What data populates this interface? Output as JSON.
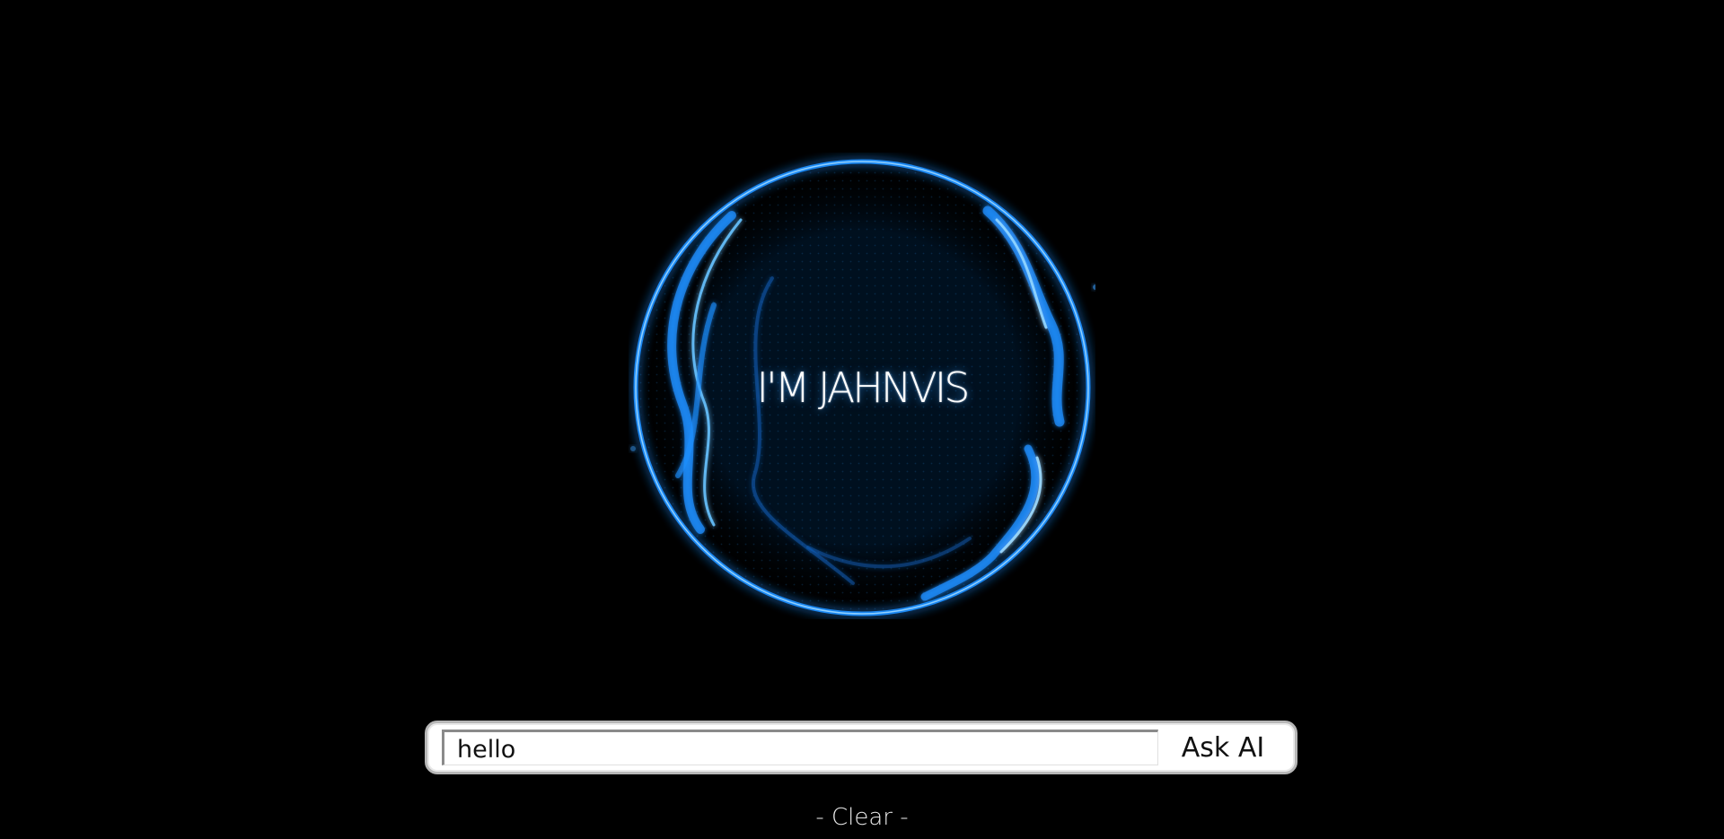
{
  "orb": {
    "title": "I'M JAHNVIS",
    "glow_color": "#1e90ff",
    "icon": "glowing-particle-sphere"
  },
  "ask": {
    "input_value": "hello",
    "button_label": "Ask AI"
  },
  "clear": {
    "label": "- Clear -"
  },
  "colors": {
    "background": "#000000",
    "accent": "#1e90ff",
    "text": "#ffffff"
  }
}
